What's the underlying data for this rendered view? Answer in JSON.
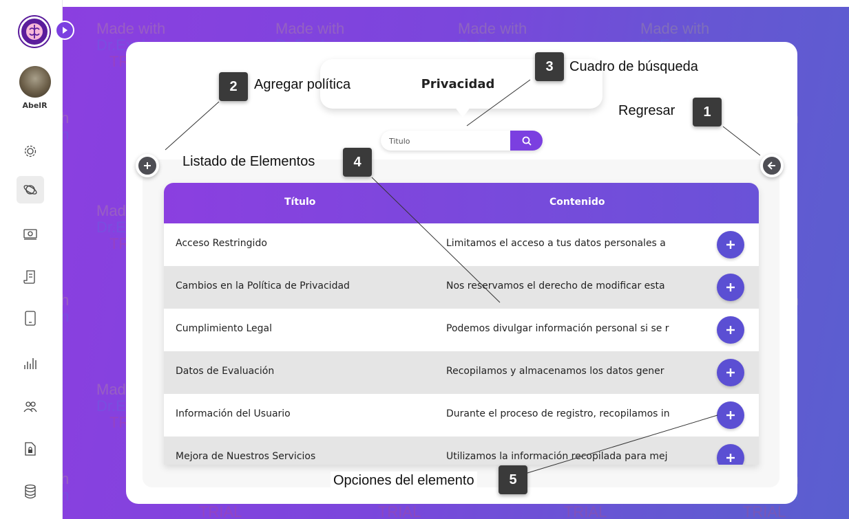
{
  "sidebar": {
    "user_name": "AbelR",
    "items": [
      {
        "icon": "gear-icon"
      },
      {
        "icon": "planet-icon",
        "active": true
      },
      {
        "icon": "money-icon"
      },
      {
        "icon": "document-icon"
      },
      {
        "icon": "tablet-icon"
      },
      {
        "icon": "bar-chart-icon"
      },
      {
        "icon": "users-icon"
      },
      {
        "icon": "lock-file-icon"
      },
      {
        "icon": "database-icon"
      }
    ]
  },
  "page": {
    "title": "Privacidad"
  },
  "search": {
    "placeholder": "Titulo"
  },
  "table": {
    "columns": [
      "Título",
      "Contenido"
    ],
    "rows": [
      {
        "title": "Acceso Restringido",
        "content": "Limitamos el acceso a tus datos personales a"
      },
      {
        "title": "Cambios en la Política de Privacidad",
        "content": "Nos reservamos el derecho de modificar esta"
      },
      {
        "title": "Cumplimiento Legal",
        "content": "Podemos divulgar información personal si se r"
      },
      {
        "title": "Datos de Evaluación",
        "content": "Recopilamos y almacenamos los datos gener"
      },
      {
        "title": "Información del Usuario",
        "content": "Durante el proceso de registro, recopilamos in"
      },
      {
        "title": "Mejora de Nuestros Servicios",
        "content": "Utilizamos la información recopilada para mej"
      }
    ]
  },
  "callouts": {
    "c1": {
      "num": "1",
      "text": "Regresar"
    },
    "c2": {
      "num": "2",
      "text": "Agregar política"
    },
    "c3": {
      "num": "3",
      "text": "Cuadro de búsqueda"
    },
    "c4": {
      "num": "4",
      "text": "Listado de Elementos"
    },
    "c5": {
      "num": "5",
      "text": "Opciones del elemento"
    }
  },
  "watermark": {
    "line1": "Made with",
    "line2": "Dr.Explain",
    "line3": "TRIAL"
  },
  "colors": {
    "accent": "#7b3fe0",
    "row_button": "#5b4fd3",
    "header_start": "#8b3fe0",
    "header_end": "#6a52d8"
  }
}
